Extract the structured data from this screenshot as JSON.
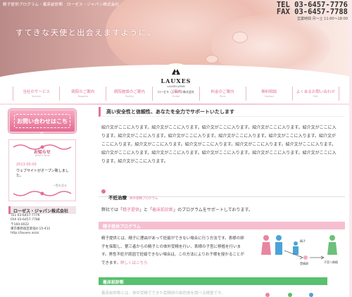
{
  "header": {
    "top_note": "精子提供プログラム・着床前診断　ローゼス・ジャパン株式会社",
    "tagline": "すてきな天使と出会えますように。",
    "tel": "TEL 03-6457-7776",
    "fax": "FAX 03-6457-7788",
    "hours": "営業時間 月〜土 11:00〜18:00"
  },
  "logo": {
    "name": "LAUXES",
    "sub": "LAUXES JAPAN",
    "company": "ローゼス・ジャパン株式会社"
  },
  "nav": [
    {
      "label": "当社のサービス",
      "en": "Service"
    },
    {
      "label": "病院のご案内",
      "en": "Hospital"
    },
    {
      "label": "病院施設のご案内",
      "en": "Facility"
    },
    {
      "label": "ご案内",
      "en": "Guide"
    },
    {
      "label": "料金のご案内",
      "en": "Price"
    },
    {
      "label": "無料相談",
      "en": "Contact"
    },
    {
      "label": "よくあるお問い合わせ",
      "en": "FAQ"
    }
  ],
  "sidebar": {
    "contact_label": "お問い合わせはこちら",
    "news": {
      "title": "お知らせ",
      "title_en": "What's New",
      "date": "2013.00.00",
      "text": "ウェブサイトがオープン致しました。",
      "more": "一覧を見る"
    },
    "company": {
      "name": "ローゼス・ジャパン株式会社",
      "lines": [
        "TEL 03-6457-7776",
        "FAX 03-6457-7788",
        "〒160-0022",
        "東京都新宿区新宿4-15-411",
        "http://lauxes.asia/"
      ]
    }
  },
  "main": {
    "h1": "高い安全性と信頼性、あなたを全力でサポートいたします",
    "intro": "紹介文がここに入ります。紹介文がここに入ります。紹介文がここに入ります。紹介文がここに入ります。紹介文がここに入ります。紹介文がここに入ります。紹介文がここに入ります。紹介文がここに入ります。紹介文がここに入ります。紹介文がここに入ります。紹介文がここに入ります。紹介文がここに入ります。紹介文がここに入ります。紹介文がここに入ります。紹介文がここに入ります。紹介文がここに入ります。紹介文がここに入ります。紹介文がここに入ります。紹介文がここに入ります。紹介文がここに入ります。",
    "h2_title": "不妊治療",
    "h2_sub": "体外受精プログラム",
    "support_pre": "弊社では「",
    "support_hl1": "精子提供",
    "support_mid": "」と「",
    "support_hl2": "着床前診断",
    "support_post": "」のプログラムをサポートしております。",
    "bar1": "精子提供プログラム",
    "p1": "精子提供とは、精子に理由があって妊娠ができない場合に行う方法です。表様の卵子を採取し、第三者からの精子との体外受精を行い、表様の子宮に移植を行います。男性不妊が原因で妊娠できない場合は、この方法によりお子様を授かることができます。",
    "p1_link": "詳しくはこちら",
    "diagram_labels": [
      "精子",
      "受精卵",
      "子宮へ移植"
    ],
    "bar2": "着床前診断",
    "p2": "着床前診断とは、体外受精でできた受精卵の染色体を調べる検査です。"
  },
  "colors": {
    "accent": "#e07494",
    "pink_bar": "#f6bfd0",
    "green_bar": "#58c06e"
  }
}
